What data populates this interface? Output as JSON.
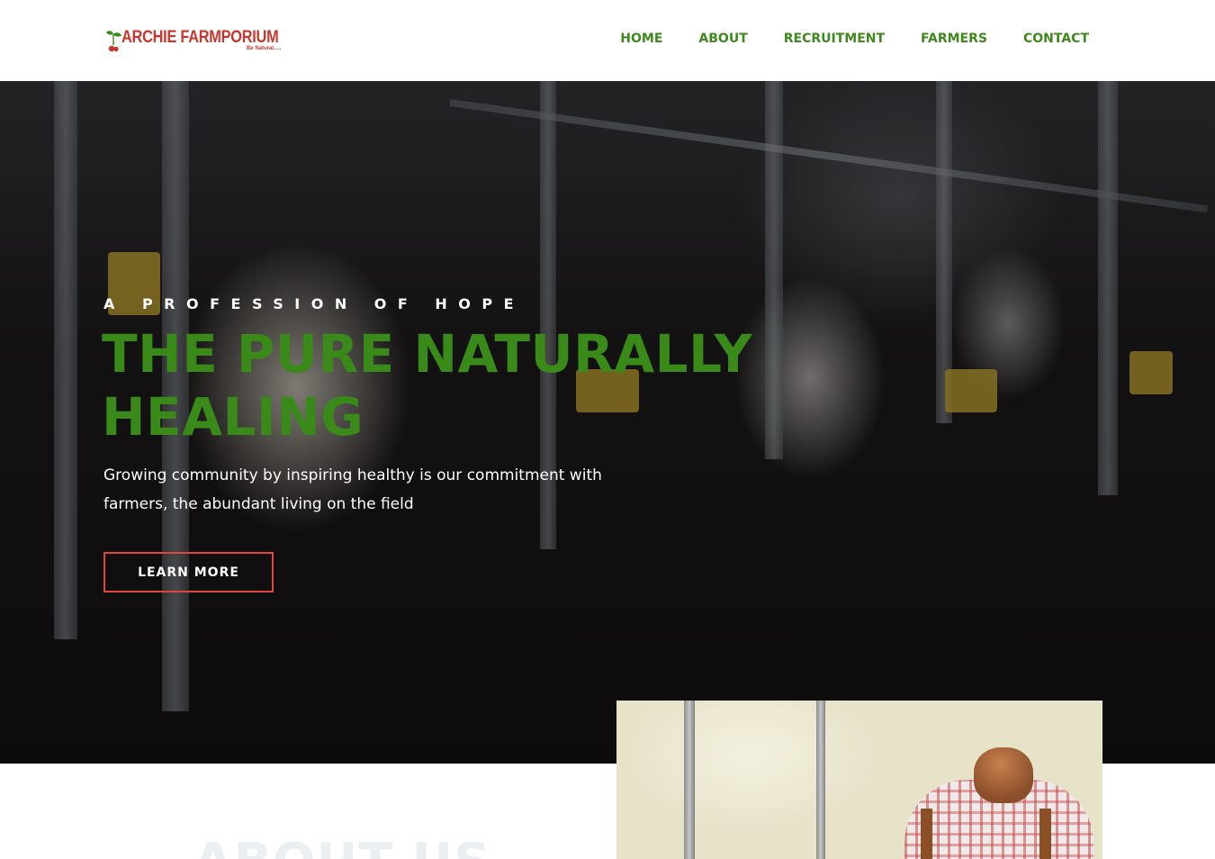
{
  "header": {
    "logo": {
      "brand": "ARCHIE FARMPORIUM",
      "tagline": "Be Natural.....",
      "brand_color": "#c8372d"
    },
    "nav": [
      {
        "label": "HOME"
      },
      {
        "label": "ABOUT"
      },
      {
        "label": "RECRUITMENT"
      },
      {
        "label": "FARMERS"
      },
      {
        "label": "CONTACT"
      }
    ],
    "nav_color": "#3f8a1e"
  },
  "hero": {
    "eyebrow": "A PROFESSION OF HOPE",
    "headline": "THE PURE NATURALLY HEALING",
    "subtext": "Growing community by inspiring healthy is our commitment with farmers, the abundant living on the field",
    "button_label": "LEARN MORE",
    "headline_color": "#3a8a1a",
    "button_border_color": "#e0463a",
    "background_image": "dairy cows in milking stalls"
  },
  "about": {
    "ghost_heading": "ABOUT US",
    "image": "farmer in plaid shirt with suspenders"
  }
}
